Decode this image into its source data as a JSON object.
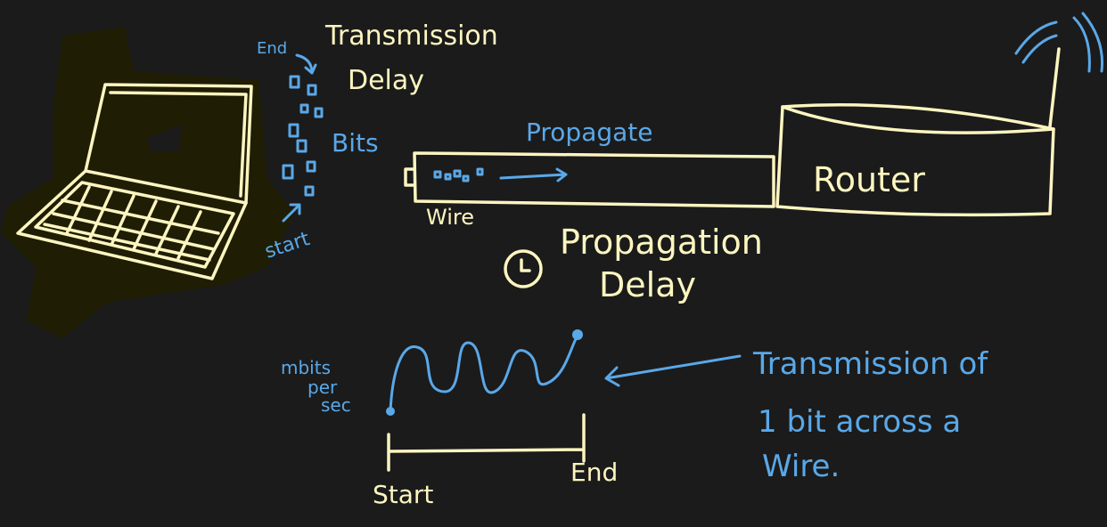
{
  "labels": {
    "end_top": "End",
    "transmission_delay_1": "Transmission",
    "transmission_delay_2": "Delay",
    "bits": "Bits",
    "start_top": "start",
    "propagate": "Propagate",
    "wire": "Wire",
    "router": "Router",
    "propagation_delay_1": "Propagation",
    "propagation_delay_2": "Delay",
    "mbits_1": "mbits",
    "mbits_2": "per",
    "mbits_3": "sec",
    "note_1": "Transmission of",
    "note_2": "1 bit across a",
    "note_3": "Wire.",
    "start_bottom": "Start",
    "end_bottom": "End"
  },
  "colors": {
    "background": "#1b1b1b",
    "cream": "#fdf5c0",
    "blue": "#5aa8e8",
    "glow": "#1f1d04"
  }
}
